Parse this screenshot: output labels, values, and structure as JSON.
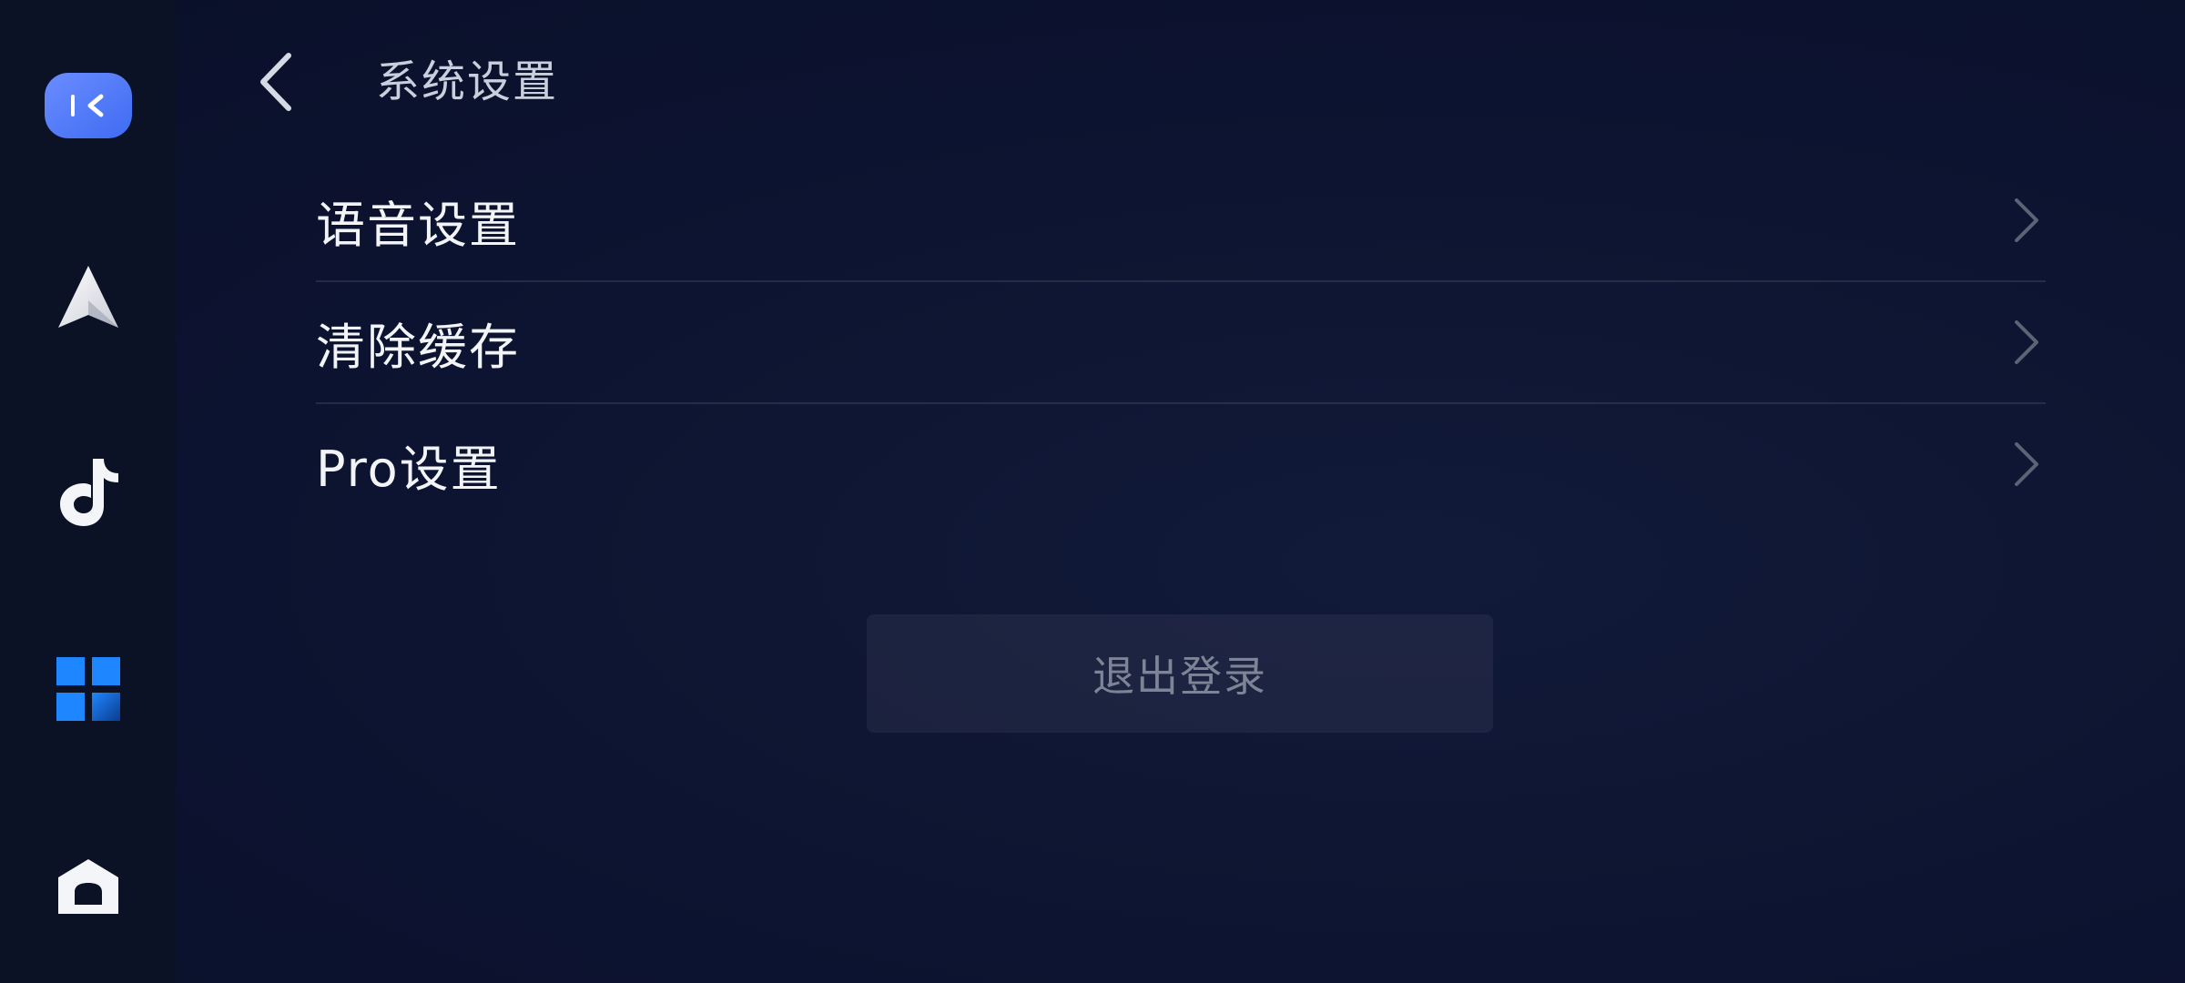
{
  "app": {
    "page_title": "系统设置"
  },
  "sidebar": {
    "items": [
      {
        "icon": "collapse-icon",
        "name": "collapse"
      },
      {
        "icon": "navigation-icon",
        "name": "navigation"
      },
      {
        "icon": "music-icon",
        "name": "music"
      },
      {
        "icon": "apps-grid-icon",
        "name": "apps"
      },
      {
        "icon": "home-icon",
        "name": "home"
      }
    ]
  },
  "header": {
    "back_icon": "chevron-left-icon"
  },
  "menu": {
    "items": [
      {
        "label": "语音设置",
        "icon": "chevron-right-icon"
      },
      {
        "label": "清除缓存",
        "icon": "chevron-right-icon"
      },
      {
        "label": "Pro设置",
        "icon": "chevron-right-icon"
      }
    ]
  },
  "logout": {
    "label": "退出登录"
  },
  "colors": {
    "accent": "#3b82f6",
    "background": "#0c1330",
    "sidebar": "#0c1226",
    "text_primary": "#f2f4f8",
    "text_muted": "#7d8496"
  }
}
